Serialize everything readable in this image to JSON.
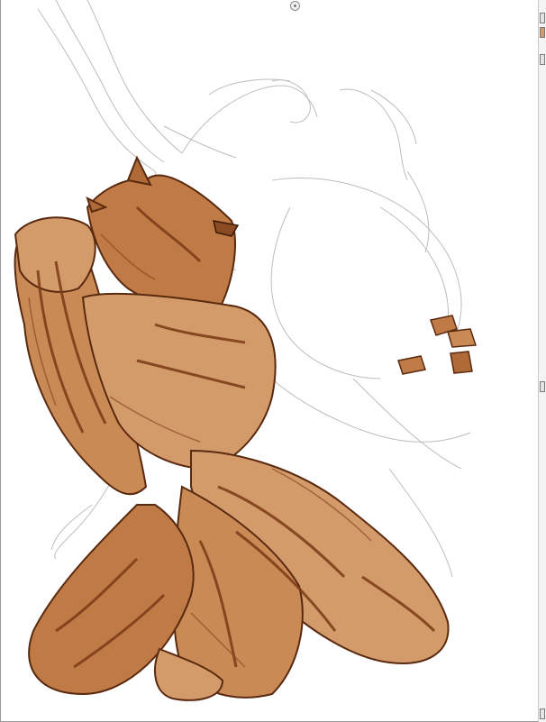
{
  "canvas": {
    "subject": "werewolf-sketch-painting",
    "colors": {
      "fur_base": "#d39a6a",
      "fur_mid": "#c07a45",
      "fur_dark": "#8a4a22",
      "fur_line": "#5a2a10",
      "sketch_line": "#b8b8b8"
    }
  },
  "right_panel": {
    "icons": [
      "panel-toggle-icon",
      "layer-icon",
      "view-icon",
      "collapse-icon",
      "corner-icon"
    ]
  },
  "canvas_handle": {
    "icon": "rotate-handle-icon"
  }
}
